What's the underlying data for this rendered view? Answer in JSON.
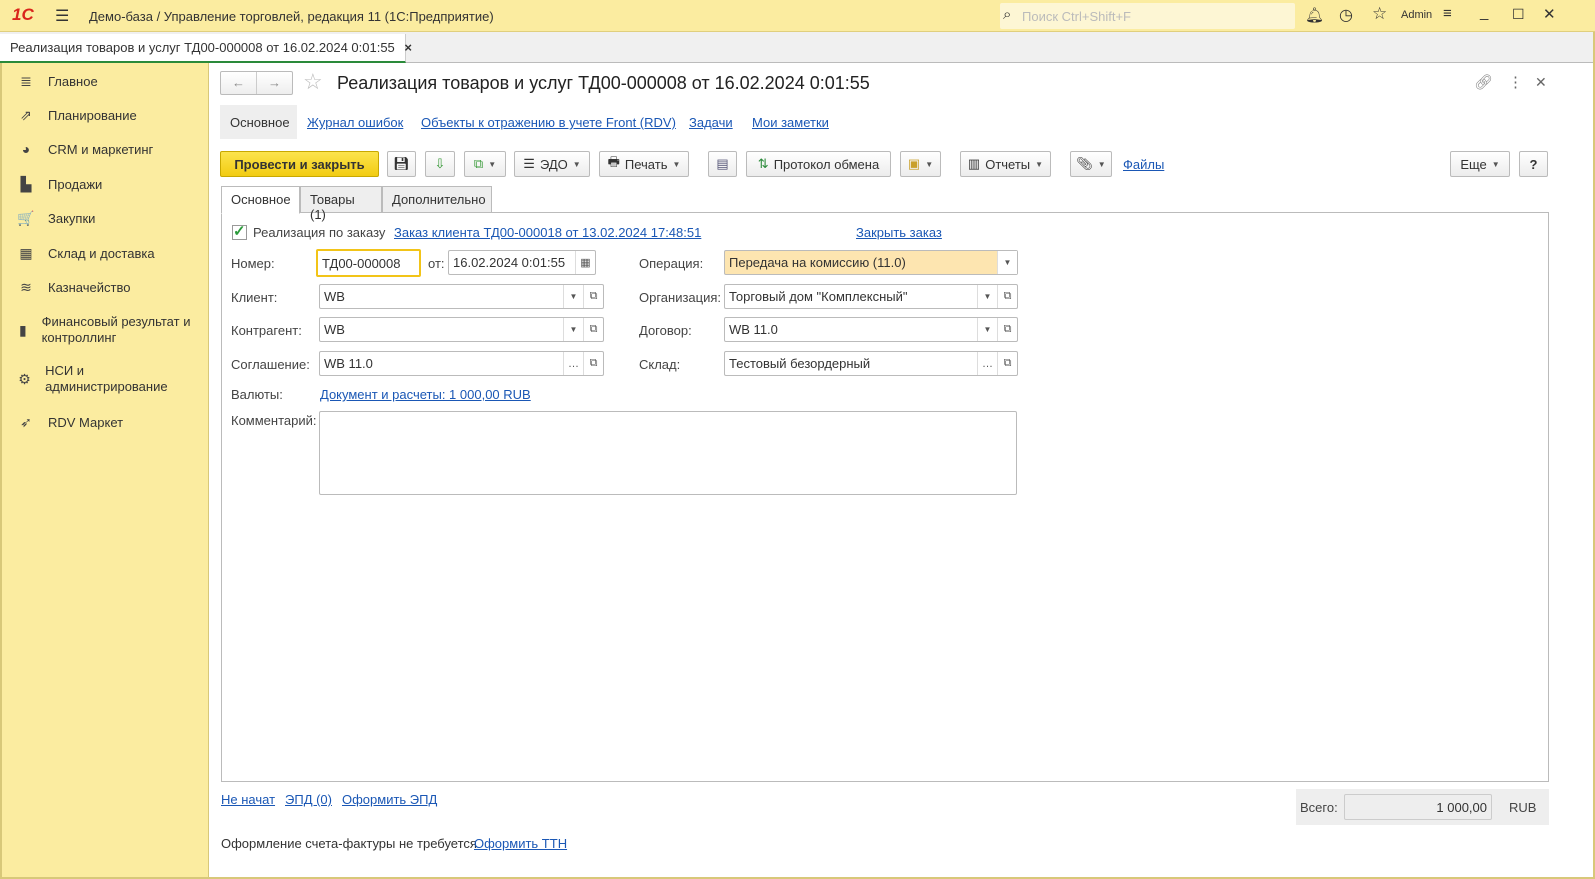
{
  "app": {
    "logo": "1С",
    "title": "Демо-база / Управление торговлей, редакция 11  (1С:Предприятие)",
    "search_placeholder": "Поиск Ctrl+Shift+F",
    "user": "Admin"
  },
  "open_tab": {
    "label": "Реализация товаров и услуг ТД00-000008 от 16.02.2024 0:01:55",
    "close": "×"
  },
  "sidebar": {
    "items": [
      {
        "label": "Главное",
        "icon": "≣"
      },
      {
        "label": "Планирование",
        "icon": "⇗"
      },
      {
        "label": "CRM и маркетинг",
        "icon": "◕"
      },
      {
        "label": "Продажи",
        "icon": "▙"
      },
      {
        "label": "Закупки",
        "icon": "🛒"
      },
      {
        "label": "Склад и доставка",
        "icon": "▦"
      },
      {
        "label": "Казначейство",
        "icon": "≋"
      },
      {
        "label": "Финансовый результат и контроллинг",
        "icon": "▮"
      },
      {
        "label": "НСИ и администрирование",
        "icon": "⚙"
      },
      {
        "label": "RDV Маркет",
        "icon": "➶"
      }
    ]
  },
  "form": {
    "title": "Реализация товаров и услуг ТД00-000008 от 16.02.2024 0:01:55",
    "nav_links": [
      "Основное",
      "Журнал ошибок",
      "Объекты к отражению в учете Front (RDV)",
      "Задачи",
      "Мои заметки"
    ],
    "toolbar": {
      "post_close": "Провести и закрыть",
      "edo": "ЭДО",
      "print": "Печать",
      "exchange_log": "Протокол обмена",
      "reports": "Отчеты",
      "files": "Файлы",
      "more": "Еще",
      "help": "?"
    },
    "tabs": [
      "Основное",
      "Товары (1)",
      "Дополнительно"
    ],
    "by_order_label": "Реализация по заказу",
    "by_order_checked": true,
    "order_link": "Заказ клиента ТД00-000018 от 13.02.2024 17:48:51",
    "close_order": "Закрыть заказ",
    "fields": {
      "number": {
        "label": "Номер:",
        "value": "ТД00-000008"
      },
      "date": {
        "label": "от:",
        "value": "16.02.2024  0:01:55"
      },
      "client": {
        "label": "Клиент:",
        "value": "WB"
      },
      "counterparty": {
        "label": "Контрагент:",
        "value": "WB"
      },
      "agreement": {
        "label": "Соглашение:",
        "value": "WB 11.0"
      },
      "operation": {
        "label": "Операция:",
        "value": "Передача на комиссию (11.0)"
      },
      "organization": {
        "label": "Организация:",
        "value": "Торговый дом \"Комплексный\""
      },
      "contract": {
        "label": "Договор:",
        "value": "WB 11.0"
      },
      "warehouse": {
        "label": "Склад:",
        "value": "Тестовый безордерный"
      },
      "currency": {
        "label": "Валюты:",
        "value": "Документ и расчеты: 1 000,00 RUB"
      },
      "comment": {
        "label": "Комментарий:",
        "value": ""
      }
    },
    "footer": {
      "status": "Не начат",
      "epd": "ЭПД (0)",
      "make_epd": "Оформить ЭПД",
      "total_label": "Всего:",
      "total": "1 000,00",
      "currency": "RUB",
      "invoice_note": "Оформление счета-фактуры не требуется",
      "make_ttn": "Оформить ТТН"
    }
  }
}
